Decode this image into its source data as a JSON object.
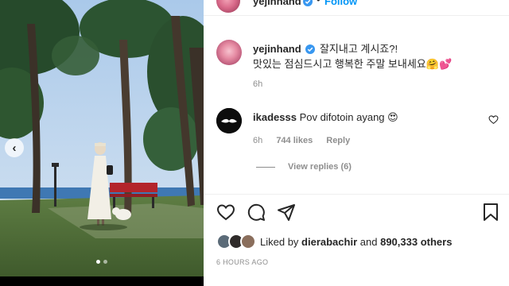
{
  "post": {
    "photo_alt": "Woman in white dress with white dog near red bench under pine trees by the sea",
    "carousel": {
      "slides": 2,
      "active_index": 0
    },
    "icons": {
      "prev": "chevron-left-icon"
    }
  },
  "header": {
    "username": "yejinhand",
    "separator": "•",
    "follow_label": "Follow",
    "verified": true
  },
  "caption": {
    "username": "yejinhand",
    "line1": "잘지내고 계시죠?!",
    "line2": "맛있는 점심드시고 행복한 주말 보내세요🤗💕",
    "time": "6h"
  },
  "comment": {
    "username": "ikadesss",
    "text": "Pov difotoin ayang 😍",
    "time": "6h",
    "likes": "744 likes",
    "reply_label": "Reply",
    "view_replies": "View replies (6)"
  },
  "actions": {
    "icons": [
      "heart-icon",
      "comment-icon",
      "share-icon",
      "bookmark-icon"
    ]
  },
  "likes": {
    "prefix": "Liked by",
    "liker": "dierabachir",
    "middle": "and",
    "others": "890,333 others"
  },
  "timestamp": "6 HOURS AGO",
  "colors": {
    "link_blue": "#0095f6",
    "verified_blue": "#3897f0",
    "muted_gray": "#8e8e8e",
    "text": "#262626"
  }
}
